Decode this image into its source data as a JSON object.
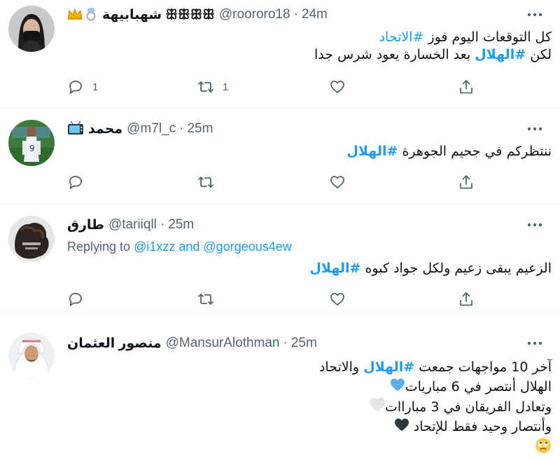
{
  "tweets": [
    {
      "display_name": "شهبابيهة ꕥꕥꕥꕥ",
      "badges": [
        "crown-emoji",
        "ring-emoji"
      ],
      "handle": "@roororo18",
      "separator": "·",
      "time": "24m",
      "lines": [
        {
          "before": "كل التوقعات اليوم فوز ",
          "hashtag": "#الاتحاد",
          "after": ""
        },
        {
          "before": "لكن ",
          "hashtag": "#الهلال",
          "after": " بعد الخسارة يعود شرس جدا"
        }
      ],
      "reply_count": "1",
      "retweet_count": "1",
      "like_count": ""
    },
    {
      "display_name": "محمد",
      "badges": [
        "television-emoji"
      ],
      "handle": "@m7l_c",
      "separator": "·",
      "time": "25m",
      "lines": [
        {
          "before": "ننتظركم في جحيم الجوهرة ",
          "hashtag": "#الهلال",
          "after": ""
        }
      ]
    },
    {
      "display_name": "طارق",
      "handle": "@tariiqll",
      "separator": "·",
      "time": "25m",
      "replying_prefix": "Replying to ",
      "replying_user1": "@i1xzz",
      "replying_and": " and ",
      "replying_user2": "@gorgeous4ew",
      "lines": [
        {
          "before": "الزعيم يبقى زعيم ولكل جواد كبوه ",
          "hashtag": "#الهلال",
          "after": ""
        }
      ]
    },
    {
      "display_name": "منصور العثمان",
      "handle": "@MansurAlothman",
      "separator": "·",
      "time": "25m",
      "lines": [
        {
          "before": "آخر 10 مواجهات جمعت ",
          "hashtag": "#الهلال",
          "after": " والاتحاد"
        },
        {
          "before": "الهلال أنتصر في 6 مباريات",
          "emoji": "blue-heart-emoji"
        },
        {
          "before": "وتعادل الفريقان في 3 مباراات",
          "emoji": "white-heart-emoji"
        },
        {
          "before": "وأنتصار وحيد فقط للإتحاد ",
          "emoji": "black-heart-emoji"
        },
        {
          "before": "",
          "emoji": "rolling-eyes-emoji"
        }
      ]
    }
  ],
  "colors": {
    "accent": "#1d9bf0",
    "secondary_text": "#536471",
    "primary_text": "#0f1419",
    "divider": "#eff3f4"
  },
  "icons": [
    "reply-icon",
    "retweet-icon",
    "like-icon",
    "share-icon",
    "more-options-icon"
  ]
}
